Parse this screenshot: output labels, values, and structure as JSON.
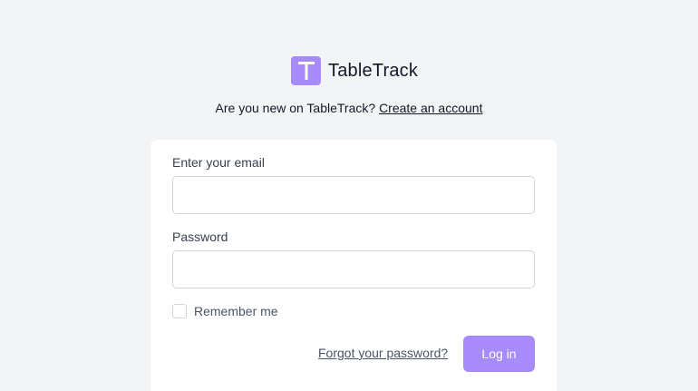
{
  "brand": {
    "name": "TableTrack",
    "logo_letter_icon": "letter-t-icon",
    "accent_color": "#a78bfa"
  },
  "signup_prompt": {
    "text": "Are you new on TableTrack?",
    "link_label": "Create an account"
  },
  "form": {
    "email_label": "Enter your email",
    "email_value": "",
    "password_label": "Password",
    "password_value": "",
    "remember_label": "Remember me",
    "remember_checked": false,
    "forgot_label": "Forgot your password?",
    "submit_label": "Log in"
  }
}
